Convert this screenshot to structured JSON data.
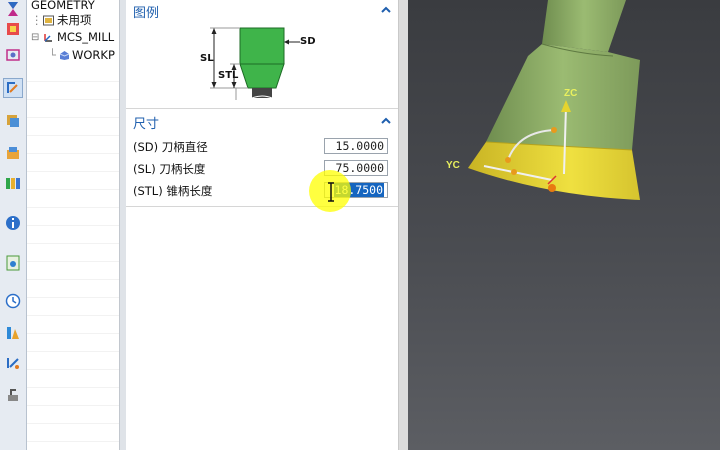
{
  "navigator": {
    "items": [
      {
        "label": "GEOMETRY"
      },
      {
        "label": "未用项"
      },
      {
        "label": "MCS_MILL"
      },
      {
        "label": "WORKP"
      }
    ]
  },
  "toolstrip": {
    "icons": [
      "hourglass-icon",
      "part-navigator-icon",
      "reuse-library-icon",
      "tool-select-icon",
      "layer-icon",
      "assembly-icon",
      "palette-icon",
      "info-icon",
      "web-icon",
      "history-icon",
      "roles-icon",
      "operation-nav-icon",
      "machine-nav-icon"
    ]
  },
  "dialog": {
    "diagram_section": {
      "title": "图例"
    },
    "diagram_labels": {
      "sd": "SD",
      "sl": "SL",
      "stl": "STL"
    },
    "size_section": {
      "title": "尺寸"
    },
    "fields": [
      {
        "label": "(SD) 刀柄直径",
        "value": "15.0000"
      },
      {
        "label": "(SL) 刀柄长度",
        "value": "75.0000"
      },
      {
        "label": "(STL) 锥柄长度",
        "value": "18.7500"
      }
    ]
  },
  "viewport": {
    "axis_labels": {
      "zc": "ZC",
      "yc": "YC"
    }
  },
  "colors": {
    "accent": "#1f5fae",
    "tool_green": "#3fb44a",
    "model_green": "#8fae69",
    "model_yellow": "#e5d42e",
    "selection": "#1565c0"
  }
}
